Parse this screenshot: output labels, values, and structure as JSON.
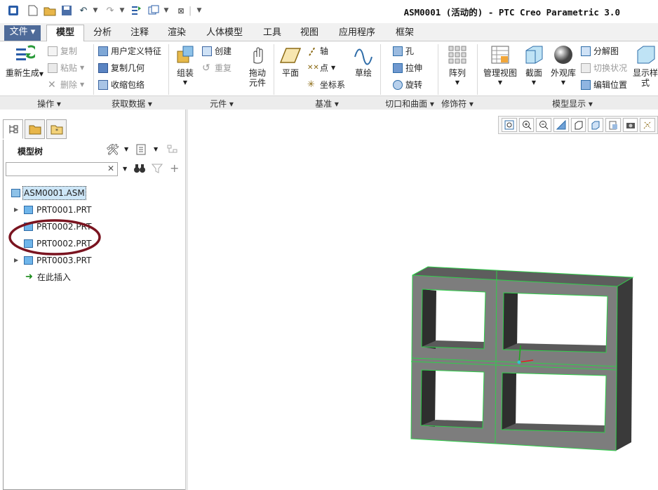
{
  "window": {
    "title": "ASM0001 (活动的) - PTC Creo Parametric 3.0"
  },
  "tabs": [
    {
      "label": "文件"
    },
    {
      "label": "模型"
    },
    {
      "label": "分析"
    },
    {
      "label": "注释"
    },
    {
      "label": "渲染"
    },
    {
      "label": "人体模型"
    },
    {
      "label": "工具"
    },
    {
      "label": "视图"
    },
    {
      "label": "应用程序"
    },
    {
      "label": "框架"
    }
  ],
  "ribbon": {
    "operations": {
      "label": "操作",
      "regenerate": "重新生成",
      "copy": "复制",
      "paste": "粘贴",
      "delete": "删除"
    },
    "getdata": {
      "label": "获取数据",
      "udf": "用户定义特征",
      "copygeom": "复制几何",
      "shrinkwrap": "收缩包络"
    },
    "component": {
      "label": "元件",
      "assemble": "组装",
      "create": "创建",
      "repeat": "重复",
      "drag": "拖动\n元件"
    },
    "datum": {
      "label": "基准",
      "plane": "平面",
      "axis": "轴",
      "point": "点",
      "csys": "坐标系",
      "sketch": "草绘"
    },
    "cut": {
      "label": "切口和曲面",
      "hole": "孔",
      "extrude": "拉伸",
      "revolve": "旋转"
    },
    "modifier": {
      "label": "修饰符",
      "pattern": "阵列"
    },
    "display": {
      "label": "模型显示",
      "manageview": "管理视图",
      "section": "截面",
      "appearance": "外观库",
      "explode": "分解图",
      "toggle": "切换状况",
      "editpos": "编辑位置",
      "style": "显示样\n式"
    }
  },
  "modeltree": {
    "title": "模型树",
    "search_placeholder": "",
    "items": [
      {
        "label": "ASM0001.ASM"
      },
      {
        "label": "PRT0001.PRT"
      },
      {
        "label": "PRT0002.PRT"
      },
      {
        "label": "PRT0002.PRT"
      },
      {
        "label": "PRT0003.PRT"
      },
      {
        "label": "在此插入"
      }
    ]
  },
  "colors": {
    "highlight_ellipse": "#7a1420",
    "model_edge": "#2fd04a",
    "model_face": "#7d7d7d"
  }
}
